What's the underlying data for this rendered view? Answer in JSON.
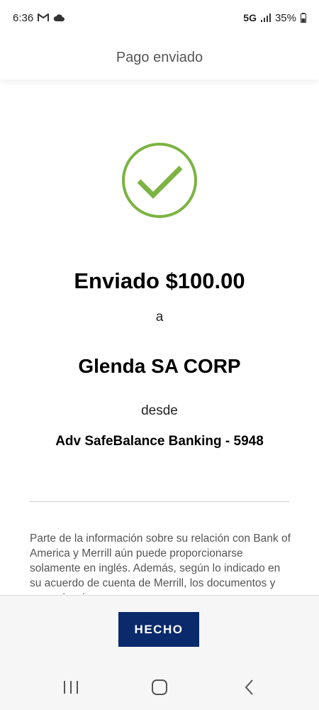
{
  "status_bar": {
    "time": "6:36",
    "network": "5G",
    "battery": "35%"
  },
  "header": {
    "title": "Pago enviado"
  },
  "confirmation": {
    "sent_text": "Enviado $100.00",
    "to_word": "a",
    "recipient": "Glenda SA CORP",
    "from_word": "desde",
    "account": "Adv SafeBalance Banking - 5948"
  },
  "disclaimer": "Parte de la información sobre su relación con Bank of America y Merrill aún puede proporcionarse solamente en inglés. Además, según lo indicado en su acuerdo de cuenta de Merrill, los documentos y comunicaciones",
  "footer": {
    "done_label": "HECHO"
  },
  "colors": {
    "check": "#7cb342",
    "button": "#0a2a6b"
  }
}
